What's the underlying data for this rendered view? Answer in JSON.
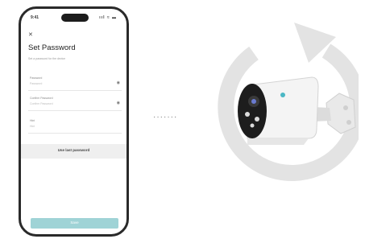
{
  "phone": {
    "status_time": "9:41",
    "status_icons": "ııl ≈ ▬",
    "close_icon": "close-icon",
    "title": "Set Password",
    "description": "Set a password for the device",
    "fields": [
      {
        "label": "Password",
        "placeholder": "Password",
        "icon": "eye-icon"
      },
      {
        "label": "Confirm Password",
        "placeholder": "Confirm Password",
        "icon": "eye-icon"
      },
      {
        "label": "Hint",
        "placeholder": "Hint",
        "icon": ""
      }
    ],
    "use_last_password": "Use last password",
    "save": "Save"
  },
  "connector": "·······",
  "graphics": {
    "refresh_icon": "refresh-icon",
    "camera_icon": "bullet-camera-icon",
    "accent": "#9fd3d6",
    "ring_color": "#e3e3e3"
  }
}
